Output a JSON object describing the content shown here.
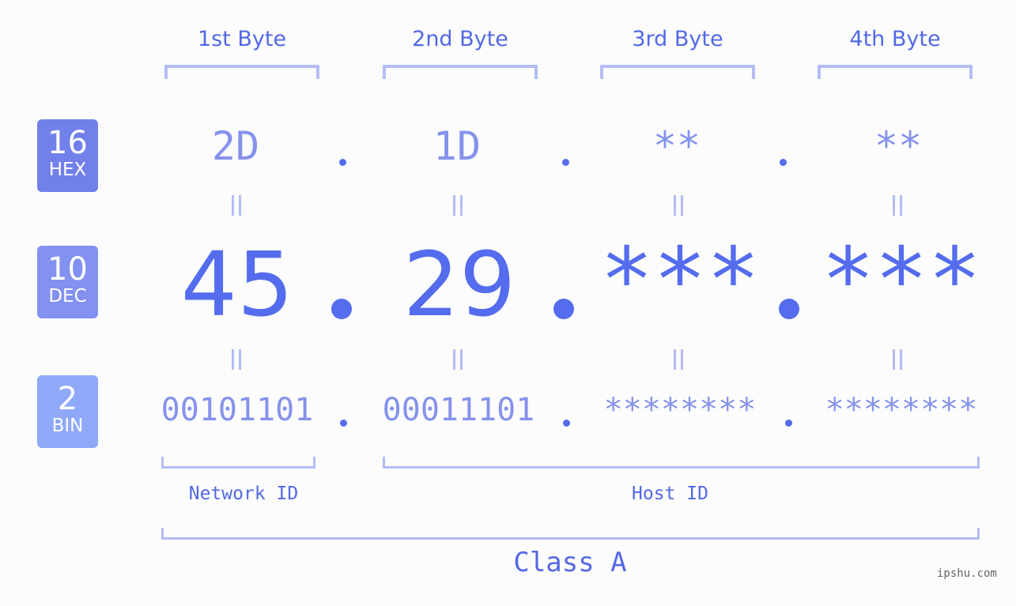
{
  "headers": [
    "1st Byte",
    "2nd Byte",
    "3rd Byte",
    "4th Byte"
  ],
  "badges": {
    "hex": {
      "num": "16",
      "label": "HEX",
      "color": "#7280ea"
    },
    "dec": {
      "num": "10",
      "label": "DEC",
      "color": "#8391f0"
    },
    "bin": {
      "num": "2",
      "label": "BIN",
      "color": "#8fa8f8"
    }
  },
  "hex_values": [
    "2D",
    "1D",
    "**",
    "**"
  ],
  "dec_values": [
    "45",
    "29",
    "***",
    "***"
  ],
  "bin_values": [
    "00101101",
    "00011101",
    "********",
    "********"
  ],
  "separator": ".",
  "labels": {
    "network": "Network ID",
    "host": "Host ID",
    "class": "Class A"
  },
  "watermark": "ipshu.com",
  "colors": {
    "accent": "#546ced",
    "light": "#8592ec",
    "bracket": "#b3bdf6"
  }
}
